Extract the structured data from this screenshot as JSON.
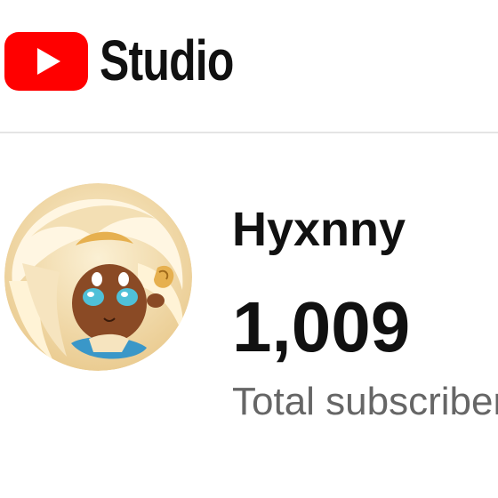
{
  "header": {
    "logo_icon": "youtube-play-icon",
    "brand_color": "#ff0000",
    "title": "Studio"
  },
  "channel": {
    "avatar_icon": "channel-avatar",
    "name": "Hyxnny",
    "subscriber_count": "1,009",
    "subscriber_label": "Total subscribers"
  },
  "colors": {
    "text_primary": "#111111",
    "text_secondary": "#666666",
    "divider": "#e4e4e4"
  }
}
